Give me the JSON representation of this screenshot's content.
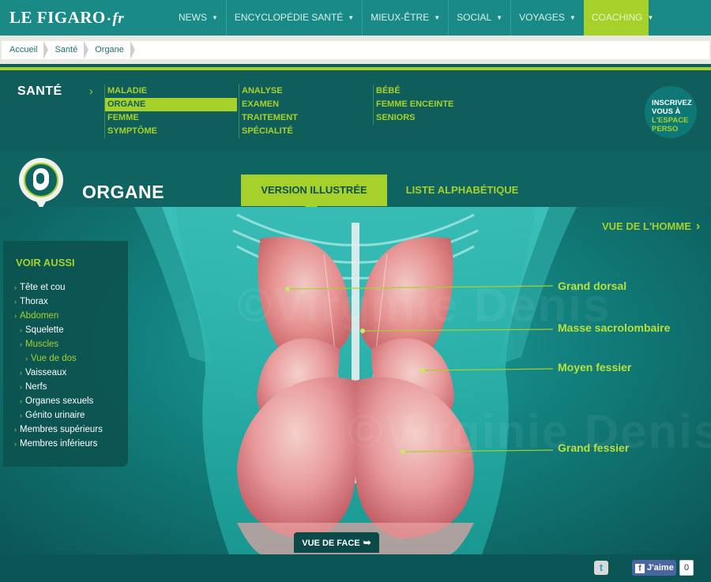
{
  "header": {
    "logo_main": "LE FIGARO",
    "logo_dot": "•",
    "logo_suffix": "fr",
    "nav": [
      {
        "label": "NEWS"
      },
      {
        "label": "ENCYCLOPÉDIE SANTÉ"
      },
      {
        "label": "MIEUX-ÊTRE"
      },
      {
        "label": "SOCIAL"
      },
      {
        "label": "VOYAGES"
      },
      {
        "label": "COACHING",
        "active": true
      }
    ],
    "caret_icon": "chevron-down-icon"
  },
  "breadcrumb": [
    "Accueil",
    "Santé",
    "Organe"
  ],
  "sante_menu": {
    "title": "SANTÉ",
    "col1": [
      "MALADIE",
      "ORGANE",
      "FEMME",
      "SYMPTÔME"
    ],
    "col2": [
      "ANALYSE",
      "EXAMEN",
      "TRAITEMENT",
      "SPÉCIALITÉ"
    ],
    "col3": [
      "BÉBÉ",
      "FEMME ENCEINTE",
      "SENIORS"
    ],
    "selected": "ORGANE",
    "signup": {
      "line1": "INSCRIVEZ",
      "line2": "VOUS À",
      "line3": "L'ESPACE",
      "line4": "PERSO"
    }
  },
  "organe": {
    "title": "ORGANE",
    "tabs": [
      "VERSION ILLUSTRÉE",
      "LISTE ALPHABÉTIQUE"
    ],
    "active_tab": "VERSION ILLUSTRÉE"
  },
  "illustration": {
    "view_toggle": "VUE DE L'HOMME",
    "labels": [
      "Grand dorsal",
      "Masse sacrolombaire",
      "Moyen fessier",
      "Grand fessier"
    ],
    "watermark": "©Virginie Denis",
    "face_button": "VUE DE FACE"
  },
  "voir_aussi": {
    "title": "VOIR AUSSI",
    "items": [
      {
        "label": "Tête et cou",
        "level": 1
      },
      {
        "label": "Thorax",
        "level": 1
      },
      {
        "label": "Abdomen",
        "level": 1,
        "highlight": true
      },
      {
        "label": "Squelette",
        "level": 2
      },
      {
        "label": "Muscles",
        "level": 2,
        "highlight": true
      },
      {
        "label": "Vue de dos",
        "level": 3,
        "highlight": true
      },
      {
        "label": "Vaisseaux",
        "level": 2
      },
      {
        "label": "Nerfs",
        "level": 2
      },
      {
        "label": "Organes sexuels",
        "level": 2
      },
      {
        "label": "Génito urinaire",
        "level": 2
      },
      {
        "label": "Membres supérieurs",
        "level": 1
      },
      {
        "label": "Membres inférieurs",
        "level": 1
      }
    ]
  },
  "footer": {
    "like_label": "J'aime",
    "like_count": "0"
  },
  "colors": {
    "accent": "#a6d12b",
    "teal_dark": "#0c5e5c",
    "teal": "#1a8a86"
  }
}
